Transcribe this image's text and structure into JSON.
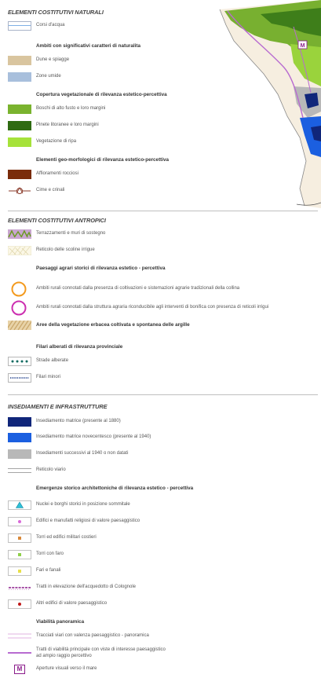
{
  "colors": {
    "dune": "#d9c59f",
    "zone_umide": "#a8bfdc",
    "boschi": "#7ab32e",
    "pinete": "#2f6b12",
    "vegetazione_ripa": "#a6e23a",
    "affioramenti": "#7a2c0a",
    "insediamento_1880": "#10267a",
    "insediamento_1940": "#1b5fe0",
    "insediamenti_successivi": "#b8b8b8",
    "ambiti_orange": "#f39a1e",
    "ambiti_magenta": "#cc2fb0",
    "viabilita": "#b86bd0"
  },
  "sections": {
    "naturali": "ELEMENTI COSTITUTIVI NATURALI",
    "antropici": "ELEMENTI COSTITUTIVI ANTROPICI",
    "insediamenti": "INSEDIAMENTI E INFRASTRUTTURE"
  },
  "naturali": {
    "corsi": "Corsi d'acqua",
    "sub_ambiti": "Ambiti con significativi caratteri di naturalita",
    "dune": "Dune e spiagge",
    "zone_umide": "Zone umide",
    "sub_copertura": "Copertura vegetazionale di rilevanza estetico-percettiva",
    "boschi": "Boschi di alto fusto e loro margini",
    "pinete": "Pinete litoranee e loro margini",
    "vegetazione": "Vegetazione di ripa",
    "sub_geo": "Elementi geo-morfologici di rilevanza estetico-percettiva",
    "affioramenti": "Affioramenti rocciosi",
    "cime": "Cime e crinali"
  },
  "antropici": {
    "terrazzamenti": "Terrazzamenti e muri di sostegno",
    "reticolo_scoline": "Reticolo delle scoline irrigue",
    "sub_paesaggi": "Paesaggi agrari storici di rilevanza estetico - percettiva",
    "ambiti_collina": "Ambiti rurali connotati dalla presenza di coltivazioni e sistemazioni agrarie tradizionali della collina",
    "ambiti_bonifica": "Ambiti rurali connotati dalla struttura agraria riconducibile agli interventi di bonifica con presenza di reticoli irrigui",
    "aree_argille": "Aree della vegetazione erbacea coltivata e spontanea delle argille",
    "sub_filari": "Filari alberati di rilevanza provinciale",
    "strade_alberate": "Strade alberate",
    "filari_minori": "Filari minori"
  },
  "insediamenti": {
    "matrice_1880": "Insediamento matrice (presente al 1880)",
    "matrice_1940": "Insediamento matrice novecentesco (presente al 1940)",
    "successivi": "Insediamenti successivi al 1940 o non datati",
    "reticolo_viario": "Reticolo viario",
    "sub_emergenze": "Emergenze storico architettoniche di rilevanza estetico - percettiva",
    "nuclei": "Nuclei e borghi storici in posizione sommitale",
    "edifici_religiosi": "Edifici e manufatti religiosi di valore paesaggistico",
    "torri_militari": "Torri ed edifici militari costieri",
    "torri_faro": "Torri con faro",
    "fari": "Fari e fanali",
    "acquedotto": "Tratti in elevazione dell'acquedotto di Colognole",
    "altri_edifici": "Altri edifici di valore paesaggistico",
    "sub_viabilita": "Viabilità panoramica",
    "tracciati": "Tracciati viari con valenza paesaggistico - panoramica",
    "tratti_line1": "Tratti di viabilità principale con viste di interesse paesaggistico",
    "tratti_line2": "ad ampio raggio percettivo",
    "aperture_symbol": "M",
    "aperture": "Aperture visuali verso il mare"
  }
}
